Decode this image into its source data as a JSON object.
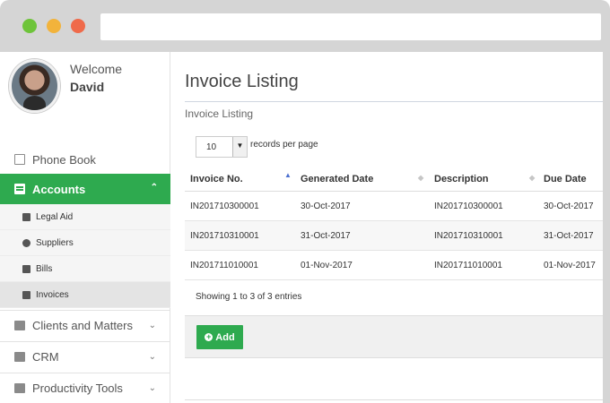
{
  "user": {
    "welcome": "Welcome",
    "name": "David"
  },
  "sidebar": {
    "phone_book": "Phone Book",
    "accounts": "Accounts",
    "subitems": [
      {
        "label": "Legal Aid",
        "icon": "document-icon"
      },
      {
        "label": "Suppliers",
        "icon": "users-icon"
      },
      {
        "label": "Bills",
        "icon": "document-icon"
      },
      {
        "label": "Invoices",
        "icon": "clipboard-icon"
      }
    ],
    "groups": [
      {
        "label": "Clients and Matters",
        "icon": "home-icon"
      },
      {
        "label": "CRM",
        "icon": "ledger-icon"
      },
      {
        "label": "Productivity Tools",
        "icon": "ledger-icon"
      }
    ]
  },
  "main": {
    "title": "Invoice Listing",
    "breadcrumb": "Invoice Listing",
    "records_select": "10",
    "records_label": "records per page",
    "columns": [
      "Invoice No.",
      "Generated Date",
      "Description",
      "Due Date"
    ],
    "rows": [
      [
        "IN201710300001",
        "30-Oct-2017",
        "IN201710300001",
        "30-Oct-2017"
      ],
      [
        "IN201710310001",
        "31-Oct-2017",
        "IN201710310001",
        "31-Oct-2017"
      ],
      [
        "IN201711010001",
        "01-Nov-2017",
        "IN201711010001",
        "01-Nov-2017"
      ]
    ],
    "info": "Showing 1 to 3 of 3 entries",
    "add_button": "Add"
  },
  "colors": {
    "accent": "#2eaa4f",
    "sort_active": "#4b6fcf"
  }
}
